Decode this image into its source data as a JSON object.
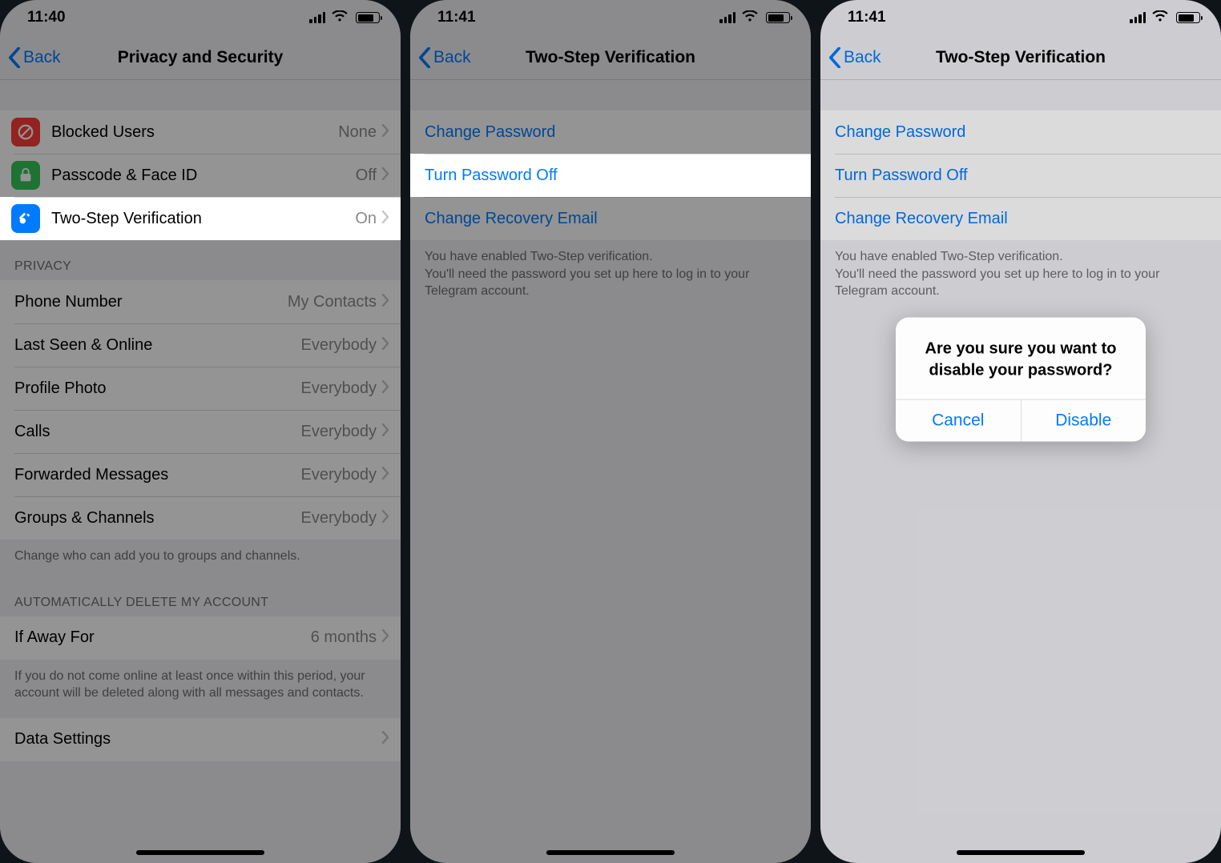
{
  "screen1": {
    "status_time": "11:40",
    "back_label": "Back",
    "title": "Privacy and Security",
    "security_rows": [
      {
        "key": "blocked",
        "label": "Blocked Users",
        "value": "None",
        "icon": "block-icon",
        "icon_color": "ico-red"
      },
      {
        "key": "passcode",
        "label": "Passcode & Face ID",
        "value": "Off",
        "icon": "lock-icon",
        "icon_color": "ico-green"
      },
      {
        "key": "twostep",
        "label": "Two-Step Verification",
        "value": "On",
        "icon": "key-icon",
        "icon_color": "ico-blue"
      }
    ],
    "privacy_header": "Privacy",
    "privacy_rows": [
      {
        "label": "Phone Number",
        "value": "My Contacts"
      },
      {
        "label": "Last Seen & Online",
        "value": "Everybody"
      },
      {
        "label": "Profile Photo",
        "value": "Everybody"
      },
      {
        "label": "Calls",
        "value": "Everybody"
      },
      {
        "label": "Forwarded Messages",
        "value": "Everybody"
      },
      {
        "label": "Groups & Channels",
        "value": "Everybody"
      }
    ],
    "privacy_footer": "Change who can add you to groups and channels.",
    "auto_delete_header": "Automatically Delete My Account",
    "auto_delete_row": {
      "label": "If Away For",
      "value": "6 months"
    },
    "auto_delete_footer": "If you do not come online at least once within this period, your account will be deleted along with all messages and contacts.",
    "data_settings_label": "Data Settings"
  },
  "screen2": {
    "status_time": "11:41",
    "back_label": "Back",
    "title": "Two-Step Verification",
    "rows": [
      {
        "key": "change_pw",
        "label": "Change Password"
      },
      {
        "key": "turn_off",
        "label": "Turn Password Off"
      },
      {
        "key": "change_email",
        "label": "Change Recovery Email"
      }
    ],
    "footer": "You have enabled Two-Step verification.\nYou'll need the password you set up here to log in to your Telegram account."
  },
  "screen3": {
    "status_time": "11:41",
    "back_label": "Back",
    "title": "Two-Step Verification",
    "rows": [
      {
        "key": "change_pw",
        "label": "Change Password"
      },
      {
        "key": "turn_off",
        "label": "Turn Password Off"
      },
      {
        "key": "change_email",
        "label": "Change Recovery Email"
      }
    ],
    "footer": "You have enabled Two-Step verification.\nYou'll need the password you set up here to log in to your Telegram account.",
    "alert": {
      "message": "Are you sure you want to disable your password?",
      "cancel": "Cancel",
      "confirm": "Disable"
    }
  }
}
